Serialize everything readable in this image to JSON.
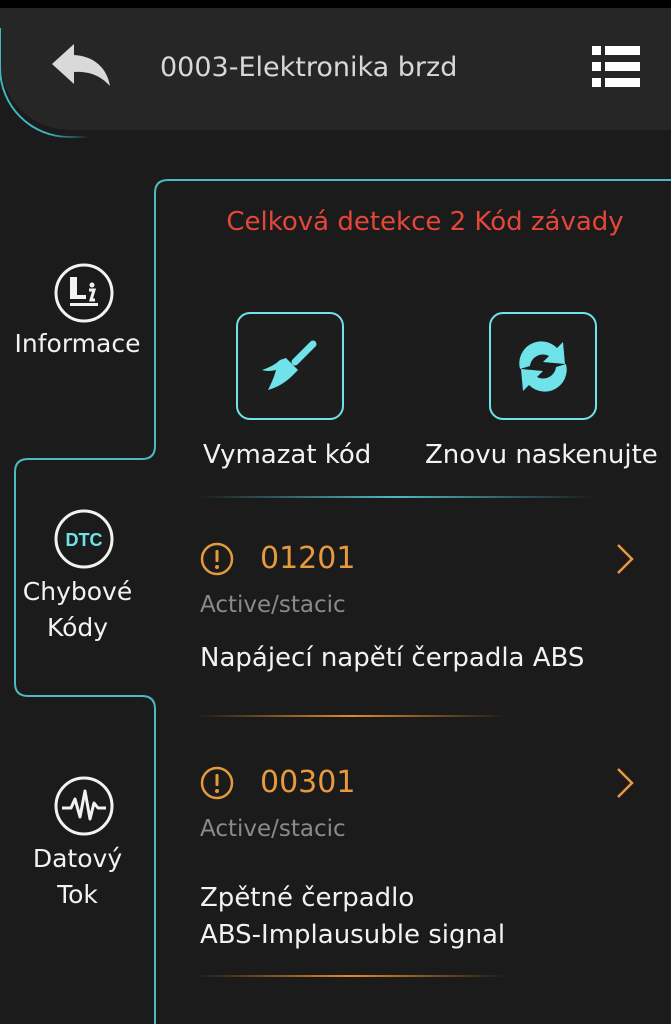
{
  "header": {
    "title": "0003-Elektronika brzd",
    "back_icon": "back-arrow-icon",
    "menu_icon": "list-menu-icon"
  },
  "sidebar": {
    "items": [
      {
        "label": "Informace",
        "icon": "info-document-icon",
        "selected": false
      },
      {
        "label": "Chybové\nKódy",
        "icon_text": "DTC",
        "icon": "dtc-icon",
        "selected": true
      },
      {
        "label": "Datový\nTok",
        "icon": "waveform-icon",
        "selected": false
      }
    ]
  },
  "summary": {
    "text": "Celková detekce 2 Kód závady"
  },
  "actions": {
    "clear_label": "Vymazat kód",
    "clear_icon": "broom-icon",
    "rescan_label": "Znovu naskenujte",
    "rescan_icon": "refresh-icon"
  },
  "dtcs": [
    {
      "code": "01201",
      "status": "Active/stacic",
      "description": "Napájecí napětí čerpadla ABS"
    },
    {
      "code": "00301",
      "status": "Active/stacic",
      "description": "Zpětné čerpadlo\nABS-Implausuble signal"
    }
  ],
  "colors": {
    "accent_teal": "#6fe2ea",
    "summary_red": "#e5463a",
    "code_orange": "#e69a3c"
  }
}
